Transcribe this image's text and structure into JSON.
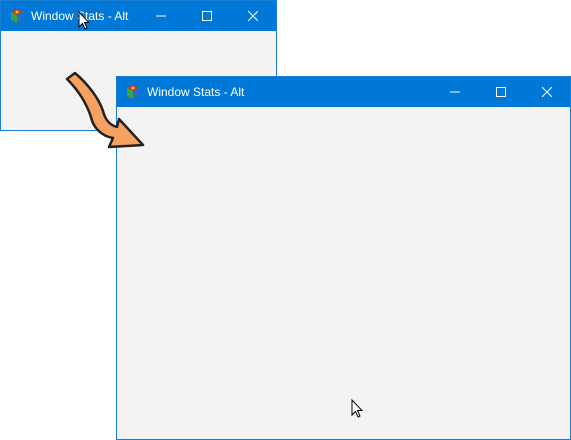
{
  "windows": [
    {
      "title": "Window Stats - Alt",
      "role": "original",
      "icon": "app-cube-icon"
    },
    {
      "title": "Window Stats - Alt",
      "role": "resized",
      "icon": "app-cube-icon"
    }
  ],
  "caption_buttons": [
    "minimize-icon",
    "maximize-icon",
    "close-icon"
  ],
  "colors": {
    "titlebar": "#0078d7",
    "client": "#f4f3f1",
    "border": "#1a7fd4",
    "arrow_fill": "#f6a15f",
    "arrow_stroke": "#222222"
  }
}
